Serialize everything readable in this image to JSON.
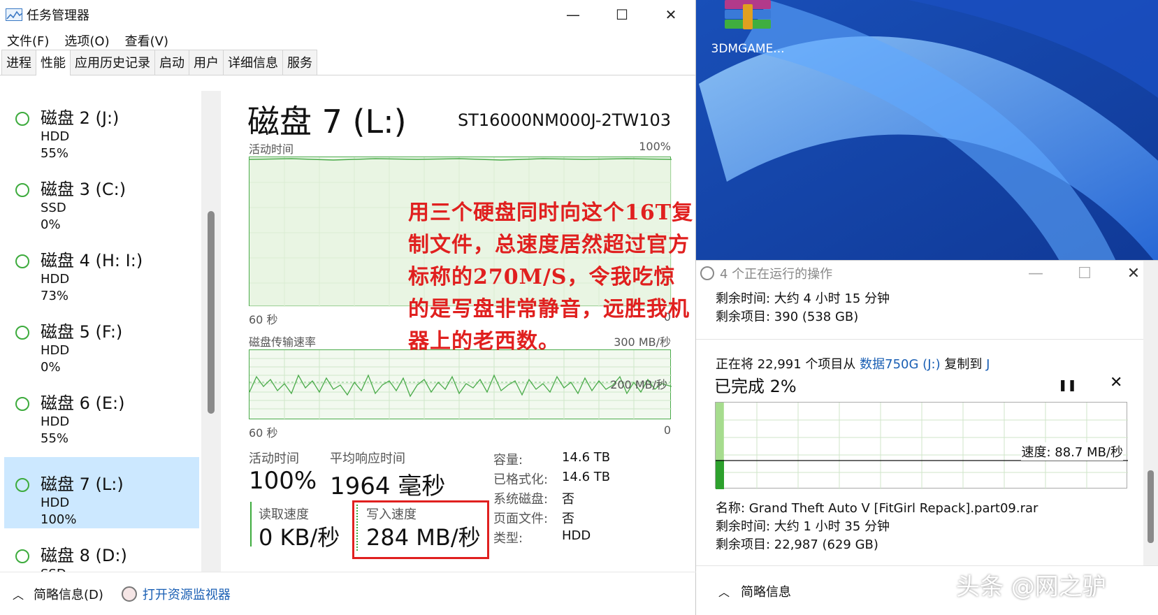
{
  "taskmanager": {
    "title": "任务管理器",
    "window_controls": {
      "minimize": "—",
      "maximize": "☐",
      "close": "✕"
    },
    "menu": [
      "文件(F)",
      "选项(O)",
      "查看(V)"
    ],
    "tabs": [
      "进程",
      "性能",
      "应用历史记录",
      "启动",
      "用户",
      "详细信息",
      "服务"
    ],
    "active_tab": "性能",
    "disks": [
      {
        "name": "磁盘 2 (J:)",
        "type": "HDD",
        "usage": "55%"
      },
      {
        "name": "磁盘 3 (C:)",
        "type": "SSD",
        "usage": "0%"
      },
      {
        "name": "磁盘 4 (H: I:)",
        "type": "HDD",
        "usage": "73%"
      },
      {
        "name": "磁盘 5 (F:)",
        "type": "HDD",
        "usage": "0%"
      },
      {
        "name": "磁盘 6 (E:)",
        "type": "HDD",
        "usage": "55%"
      },
      {
        "name": "磁盘 7 (L:)",
        "type": "HDD",
        "usage": "100%",
        "selected": true
      },
      {
        "name": "磁盘 8 (D:)",
        "type": "SSD",
        "usage": ""
      }
    ],
    "detail": {
      "title": "磁盘 7 (L:)",
      "model": "ST16000NM000J-2TW103",
      "active_time_label": "活动时间",
      "active_time_max": "100%",
      "graph1_left": "60 秒",
      "graph1_right": "0",
      "transfer_label": "磁盘传输速率",
      "transfer_max": "300 MB/秒",
      "transfer_mid": "200 MB/秒",
      "graph2_left": "60 秒",
      "graph2_right": "0",
      "stats": {
        "active_time_label": "活动时间",
        "active_time": "100%",
        "avg_response_label": "平均响应时间",
        "avg_response": "1964 毫秒",
        "read_label": "读取速度",
        "read": "0 KB/秒",
        "write_label": "写入速度",
        "write": "284 MB/秒"
      },
      "properties": [
        {
          "key": "容量:",
          "value": "14.6 TB"
        },
        {
          "key": "已格式化:",
          "value": "14.6 TB"
        },
        {
          "key": "系统磁盘:",
          "value": "否"
        },
        {
          "key": "页面文件:",
          "value": "否"
        },
        {
          "key": "类型:",
          "value": "HDD"
        }
      ]
    },
    "footer": {
      "summary": "简略信息(D)",
      "resource_monitor": "打开资源监视器"
    }
  },
  "annotation": "用三个硬盘同时向这个16T复制文件，总速度居然超过官方标称的270M/S，令我吃惊的是写盘非常静音，远胜我机器上的老西数。",
  "desktop": {
    "icon_label": "3DMGAME..."
  },
  "copy_dialog": {
    "title": "4 个正在运行的操作",
    "remaining_time_1": "剩余时间: 大约 4 小时 15 分钟",
    "remaining_items_1": "剩余项目: 390 (538 GB)",
    "copy_prefix": "正在将 22,991 个项目从 ",
    "source": "数据750G (J:)",
    "copy_mid": " 复制到 ",
    "destination": "J",
    "progress_text": "已完成 2%",
    "progress_percent": 2,
    "speed": "速度: 88.7 MB/秒",
    "name": "名称: Grand Theft Auto V [FitGirl Repack].part09.rar",
    "remaining_time_2": "剩余时间: 大约 1 小时 35 分钟",
    "remaining_items_2": "剩余项目: 22,987 (629 GB)",
    "footer": "简略信息"
  },
  "watermark": "头条 @网之驴",
  "colors": {
    "disk_green": "#3dab3d",
    "selected_bg": "#cce8ff",
    "annotation_red": "#e0201f",
    "link_blue": "#1a5fb4"
  }
}
